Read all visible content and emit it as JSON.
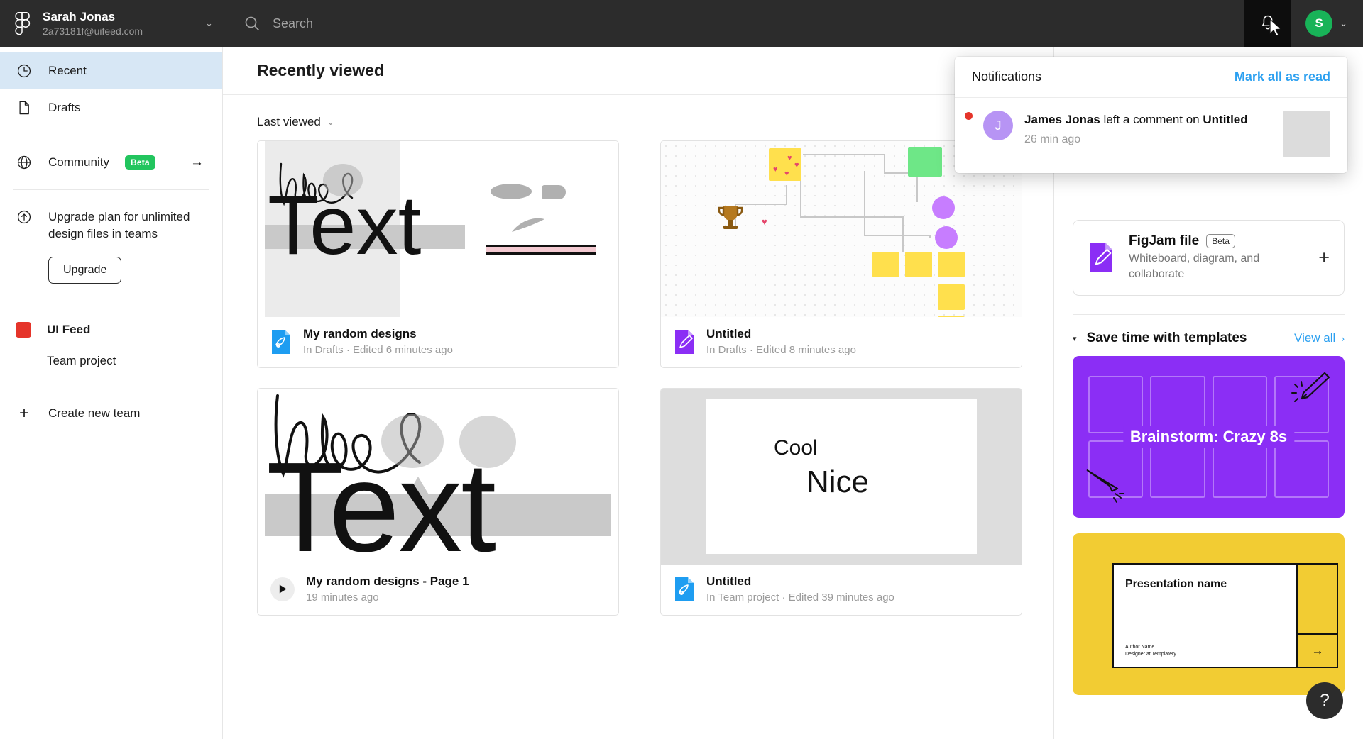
{
  "topbar": {
    "brand_name": "Sarah Jonas",
    "brand_email": "2a73181f@uifeed.com",
    "brand_caret": "⌄",
    "search_placeholder": "Search",
    "search_value": "",
    "avatar_initial": "S",
    "avatar_caret": "⌄"
  },
  "sidebar": {
    "items": [
      {
        "label": "Recent",
        "icon": "clock-icon",
        "active": true
      },
      {
        "label": "Drafts",
        "icon": "page-icon",
        "active": false
      },
      {
        "label": "Community",
        "icon": "globe-icon",
        "badge": "Beta",
        "active": false
      }
    ],
    "upgrade": {
      "text": "Upgrade plan for unlimited design files in teams",
      "button": "Upgrade",
      "icon": "arrow-up-circle-icon"
    },
    "team": {
      "name": "UI Feed",
      "color": "#e5342a",
      "project": "Team project"
    },
    "create_team": "Create new team"
  },
  "main": {
    "title": "Recently viewed",
    "sort_label": "Last viewed",
    "sort_caret": "⌄",
    "files": [
      {
        "name": "My random designs",
        "sub": "In Drafts · Edited 6 minutes ago",
        "icon": "figma-design-file-icon",
        "thumb": "hello-text"
      },
      {
        "name": "Untitled",
        "sub": "In Drafts · Edited 8 minutes ago",
        "icon": "figjam-file-icon",
        "thumb": "figjam-board"
      },
      {
        "name": "My random designs - Page 1",
        "sub": "19 minutes ago",
        "icon": "play-icon",
        "thumb": "hello-text-large"
      },
      {
        "name": "Untitled",
        "sub": "In Team project · Edited 39 minutes ago",
        "icon": "figma-design-file-icon",
        "thumb": "cool-nice-slide"
      }
    ],
    "slide_thumb": {
      "line1": "Cool",
      "line2": "Nice"
    },
    "hello_thumb": {
      "script": "hello",
      "big": "Text"
    }
  },
  "rightpanel": {
    "new_cards": [
      {
        "title": "FigJam file",
        "badge": "Beta",
        "sub": "Whiteboard, diagram, and collaborate",
        "icon": "figjam-file-icon",
        "plus": "+"
      }
    ],
    "templates": {
      "caret": "▾",
      "title": "Save time with templates",
      "view_all": "View all",
      "view_all_caret": "›",
      "cards": [
        {
          "label": "Brainstorm: Crazy 8s",
          "color": "#8b2ef5",
          "style": "crazy8s"
        },
        {
          "label": "Presentation name",
          "author": "Author Name",
          "author_sub": "Designer at Templatery",
          "arrow": "→",
          "color": "#f2cc33",
          "style": "presentation"
        }
      ]
    },
    "help_label": "?"
  },
  "notifications": {
    "title": "Notifications",
    "mark_all": "Mark all as read",
    "items": [
      {
        "actor": "James Jonas",
        "action": " left a comment on ",
        "target": "Untitled",
        "time": "26 min ago",
        "avatar_initial": "J",
        "unread": true
      }
    ]
  },
  "colors": {
    "accent_blue": "#2ca0f0",
    "brand_red": "#e5342a",
    "figjam_purple": "#8b2ef5",
    "figma_blue": "#1e9df1",
    "beta_green": "#22c55e",
    "avatar_green": "#18b358",
    "template_yellow": "#f2cc33"
  }
}
